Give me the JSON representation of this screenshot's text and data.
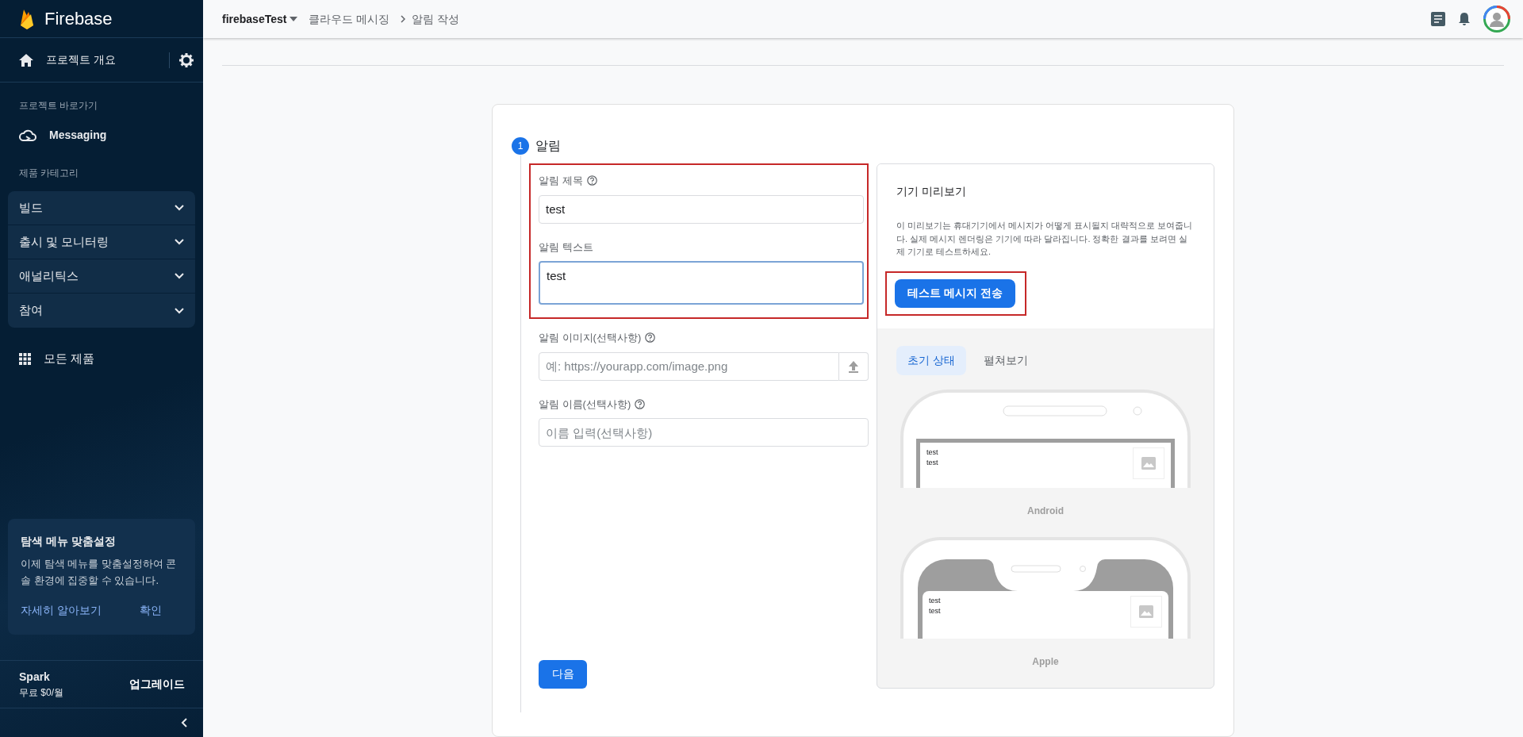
{
  "header": {
    "project": "firebaseTest",
    "breadcrumbs": [
      "클라우드 메시징",
      "알림 작성"
    ]
  },
  "sidebar": {
    "brand": "Firebase",
    "overview": "프로젝트 개요",
    "shortcuts_label": "프로젝트 바로가기",
    "shortcuts": [
      {
        "label": "Messaging"
      }
    ],
    "category_label": "제품 카테고리",
    "categories": [
      {
        "label": "빌드",
        "expanded": false
      },
      {
        "label": "출시 및 모니터링",
        "expanded": false
      },
      {
        "label": "애널리틱스",
        "expanded": false
      },
      {
        "label": "참여",
        "expanded": false
      }
    ],
    "all_products": "모든 제품",
    "promo": {
      "title": "탐색 메뉴 맞춤설정",
      "text": "이제 탐색 메뉴를 맞춤설정하여 콘솔 환경에 집중할 수 있습니다.",
      "links": [
        "자세히 알아보기",
        "확인"
      ]
    },
    "plan": {
      "name": "Spark",
      "price": "무료 $0/월",
      "upgrade": "업그레이드"
    }
  },
  "step": {
    "number": "1",
    "title": "알림",
    "fields": [
      {
        "kind": "text",
        "label": "알림 제목",
        "help": true,
        "value": "test",
        "highlighted": true,
        "focused": false
      },
      {
        "kind": "textarea",
        "label": "알림 텍스트",
        "help": false,
        "value": "test",
        "highlighted": true,
        "focused": true
      },
      {
        "kind": "upload",
        "label": "알림 이미지(선택사항)",
        "help": true,
        "placeholder": "예: https://yourapp.com/image.png",
        "highlighted": false,
        "focused": false
      },
      {
        "kind": "text",
        "label": "알림 이름(선택사항)",
        "help": true,
        "placeholder": "이름 입력(선택사항)",
        "highlighted": false,
        "focused": false
      }
    ],
    "next_button": "다음"
  },
  "preview": {
    "title": "기기 미리보기",
    "description": "이 미리보기는 휴대기기에서 메시지가 어떻게 표시될지 대략적으로 보여줍니다. 실제 메시지 렌더링은 기기에 따라 달라집니다. 정확한 결과를 보려면 실제 기기로 테스트하세요.",
    "test_button": {
      "label": "테스트 메시지 전송",
      "highlighted": true
    },
    "tabs": [
      {
        "label": "초기 상태",
        "selected": true
      },
      {
        "label": "펼쳐보기",
        "selected": false
      }
    ],
    "devices": [
      {
        "kind": "android",
        "name": "Android",
        "title": "test",
        "body": "test"
      },
      {
        "kind": "apple",
        "name": "Apple",
        "title": "test",
        "body": "test"
      }
    ]
  }
}
